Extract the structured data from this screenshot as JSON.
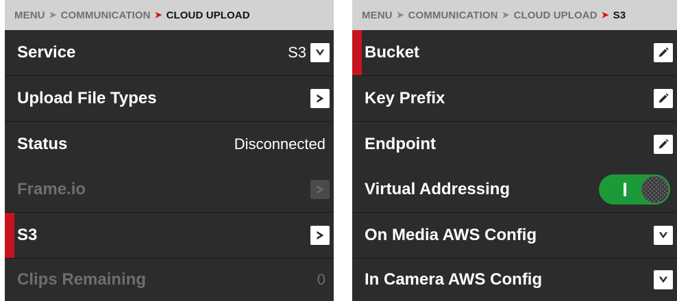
{
  "left_panel": {
    "breadcrumb": {
      "items": [
        "MENU",
        "COMMUNICATION"
      ],
      "current": "CLOUD UPLOAD"
    },
    "rows": [
      {
        "label": "Service",
        "value": "S3",
        "control": "chevron-down-icon",
        "enabled": true,
        "selected": false
      },
      {
        "label": "Upload File Types",
        "control": "chevron-right-icon",
        "enabled": true,
        "selected": false
      },
      {
        "label": "Status",
        "value": "Disconnected",
        "enabled": true,
        "selected": false
      },
      {
        "label": "Frame.io",
        "control": "chevron-right-icon",
        "enabled": false,
        "selected": false
      },
      {
        "label": "S3",
        "control": "chevron-right-icon",
        "enabled": true,
        "selected": true
      },
      {
        "label": "Clips Remaining",
        "value": "0",
        "enabled": false,
        "selected": false
      }
    ]
  },
  "right_panel": {
    "breadcrumb": {
      "items": [
        "MENU",
        "COMMUNICATION",
        "CLOUD UPLOAD"
      ],
      "current": "S3"
    },
    "rows": [
      {
        "label": "Bucket",
        "control": "pencil-icon",
        "selected": true
      },
      {
        "label": "Key Prefix",
        "control": "pencil-icon",
        "selected": false
      },
      {
        "label": "Endpoint",
        "control": "pencil-icon",
        "selected": false
      },
      {
        "label": "Virtual Addressing",
        "control": "toggle",
        "toggle_on": true,
        "selected": false
      },
      {
        "label": "On Media AWS Config",
        "control": "chevron-down-icon",
        "selected": false
      },
      {
        "label": "In Camera AWS Config",
        "control": "chevron-down-icon",
        "selected": false
      }
    ]
  },
  "colors": {
    "header_bg": "#d2d2d2",
    "row_bg": "#2c2c2c",
    "selection_accent": "#c8141e",
    "toggle_on": "#1c9a3a",
    "breadcrumb_arrow_current": "#d21414"
  }
}
